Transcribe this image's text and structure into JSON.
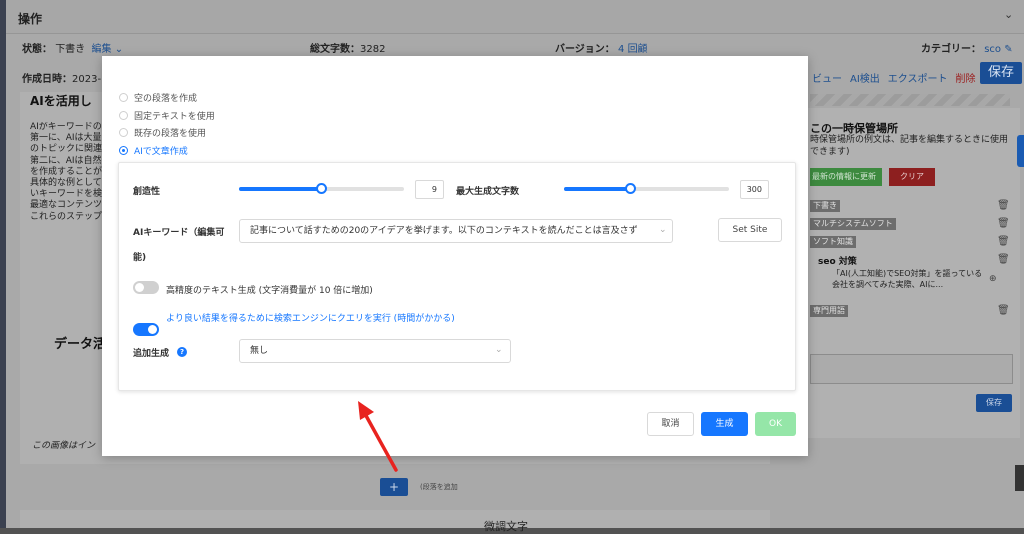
{
  "background": {
    "ops_title": "操作",
    "status_label": "状態：",
    "status_value": "下書き",
    "status_edit": "編集",
    "char_count_label": "総文字数：",
    "char_count_value": "3282",
    "version_label": "バージョン：",
    "version_value": "4",
    "version_link": "回顧",
    "category_label": "カテゴリー：",
    "category_value": "sco",
    "created_label": "作成日時：",
    "created_value": "2023-",
    "toolbar_links": [
      "ビュー",
      "AI検出",
      "エクスポート"
    ],
    "delete_label": "削除",
    "save_label": "保存",
    "editor_heading": "AIを活用し",
    "editor_lines": [
      "AIがキーワードの",
      "第一に、AIは大量",
      "のトピックに関連",
      "第二に、AIは自然",
      "を作成することが",
      "具体的な例として",
      "いキーワードを検",
      "最適なコンテンツ",
      "これらのステップ"
    ],
    "data_heading": "データ活",
    "image_note": "この画像はイン",
    "add_button": "+",
    "add_note": "(段落を追加",
    "bottom_word": "微調文字",
    "side_title": "この一時保管場所",
    "side_desc": "時保管場所の例文は、記事を編集するときに使用できます)",
    "side_update": "最新の情報に更新",
    "side_clear": "クリア",
    "side_tags": [
      "下書き",
      "マルチシステムソフト",
      "ソフト知識"
    ],
    "side_seo_title": "seo 対策",
    "side_seo_desc": "「AI(人工知能)でSEO対策」を謳っている会社を調べてみた実際、AIに...",
    "side_tag_last": "専門用語",
    "side_save": "保存"
  },
  "modal": {
    "radio_options": [
      {
        "label": "空の段落を作成",
        "selected": false
      },
      {
        "label": "固定テキストを使用",
        "selected": false
      },
      {
        "label": "既存の段落を使用",
        "selected": false
      },
      {
        "label": "AIで文章作成",
        "selected": true
      }
    ],
    "creativity_label": "創造性",
    "creativity_value": "9",
    "creativity_fraction": 0.5,
    "max_chars_label": "最大生成文字数",
    "max_chars_value": "300",
    "max_chars_fraction": 0.4,
    "keyword_label": "AIキーワード（編集可",
    "keyword_label_cont": "能)",
    "keyword_value": "記事について話すための20のアイデアを挙げます。以下のコンテキストを読んだことは言及さず",
    "set_site_button": "Set Site",
    "high_precision_label": "高精度のテキスト生成 (文字消費量が 10 倍に増加)",
    "high_precision_on": false,
    "search_engine_label": "より良い結果を得るために検索エンジンにクエリを実行 (時間がかかる)",
    "search_engine_on": true,
    "additional_label": "追加生成",
    "additional_value": "無し",
    "cancel_button": "取消",
    "generate_button": "生成",
    "ok_button": "OK",
    "accent_color": "#1677ff",
    "ok_color": "#95e6a8",
    "annotation_arrow_color": "#e8231f"
  }
}
